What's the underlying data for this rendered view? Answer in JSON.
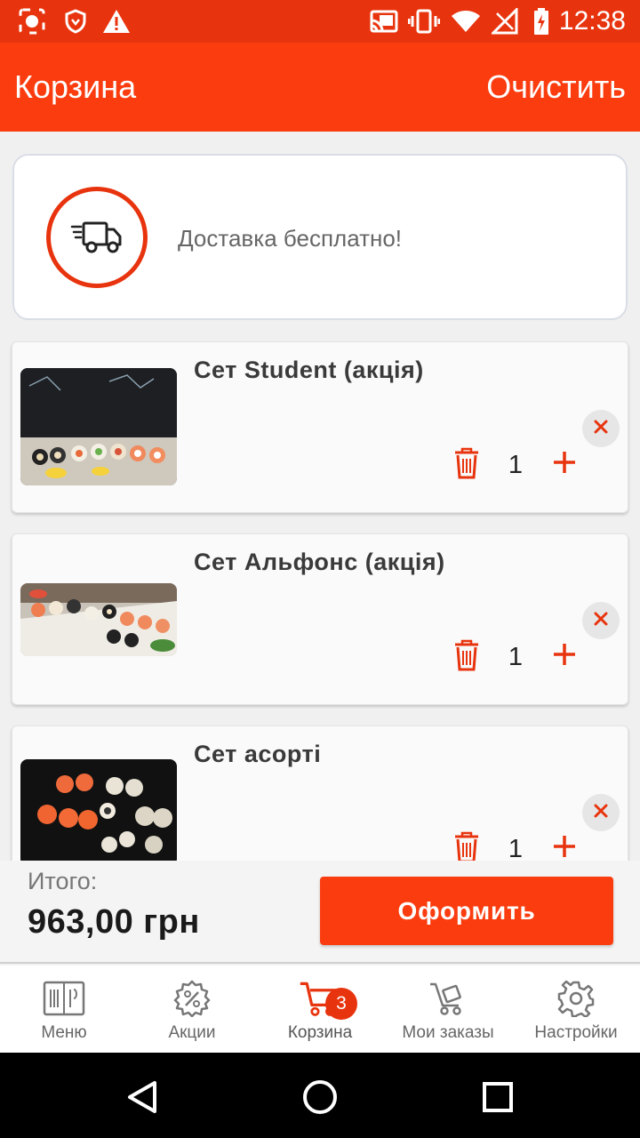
{
  "status_bar": {
    "time": "12:38"
  },
  "header": {
    "title": "Корзина",
    "clear_label": "Очистить"
  },
  "delivery": {
    "text": "Доставка бесплатно!"
  },
  "cart_items": [
    {
      "name": "Сет Student (акція)",
      "quantity": "1"
    },
    {
      "name": "Сет Альфонс (акція)",
      "quantity": "1"
    },
    {
      "name": "Сет асорті",
      "quantity": "1"
    }
  ],
  "summary": {
    "total_label": "Итого:",
    "total_value": "963,00 грн",
    "checkout_label": "Оформить"
  },
  "tabs": [
    {
      "label": "Меню",
      "icon": "menu-book-icon"
    },
    {
      "label": "Акции",
      "icon": "discount-icon"
    },
    {
      "label": "Корзина",
      "icon": "cart-icon",
      "badge": "3",
      "active": true
    },
    {
      "label": "Мои заказы",
      "icon": "orders-cart-icon"
    },
    {
      "label": "Настройки",
      "icon": "gear-icon"
    }
  ],
  "colors": {
    "accent": "#fb3c0f",
    "status_bar": "#e8340e",
    "background": "#f0f0f0"
  }
}
